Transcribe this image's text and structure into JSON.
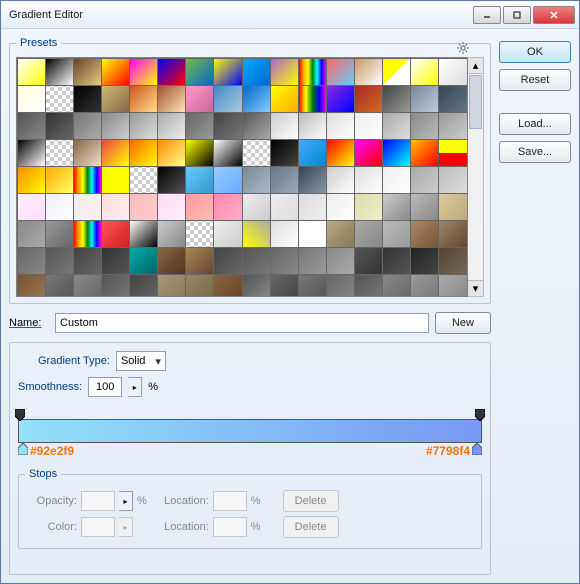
{
  "window": {
    "title": "Gradient Editor"
  },
  "buttons": {
    "ok": "OK",
    "reset": "Reset",
    "load": "Load...",
    "save": "Save...",
    "new": "New",
    "delete": "Delete"
  },
  "presets": {
    "legend": "Presets"
  },
  "name": {
    "label": "Name:",
    "value": "Custom"
  },
  "gradient": {
    "type_label": "Gradient Type:",
    "type_value": "Solid",
    "smooth_label": "Smoothness:",
    "smooth_value": "100",
    "pct": "%",
    "left_hex": "#92e2f9",
    "right_hex": "#7798f4"
  },
  "stops": {
    "legend": "Stops",
    "opacity": "Opacity:",
    "location": "Location:",
    "color": "Color:"
  },
  "swatches": [
    "linear-gradient(135deg,#fff,#ff0)",
    "linear-gradient(135deg,#000,#fff)",
    "linear-gradient(135deg,#6b4226,#e6c98a)",
    "linear-gradient(135deg,#ff0,#f00)",
    "linear-gradient(135deg,#f0f,#ff0)",
    "linear-gradient(135deg,#00f,#f00)",
    "linear-gradient(135deg,#7b4,#06c)",
    "linear-gradient(135deg,#ff0,#00f)",
    "linear-gradient(135deg,#0af,#06c)",
    "linear-gradient(135deg,#a6c,#ff0)",
    "linear-gradient(90deg,red,orange,yellow,green,cyan,blue,magenta)",
    "linear-gradient(135deg,#f66,#6cf)",
    "linear-gradient(135deg,#c96,#fff)",
    "linear-gradient(135deg,#ff0,#ff0 50%,transparent 50%)",
    "linear-gradient(135deg,#fff,#ff0)",
    "linear-gradient(135deg,#fff,#ddd)",
    "linear-gradient(135deg,#ffd,#fff)",
    "repeating-conic-gradient(#ccc 0 25%,#fff 0 50%) 0/8px 8px",
    "linear-gradient(135deg,#000,#333)",
    "linear-gradient(135deg,#cb7,#864)",
    "linear-gradient(135deg,#c52,#fd8)",
    "linear-gradient(135deg,#a0522d,#ffe4b5)",
    "linear-gradient(135deg,#f9c,#c69)",
    "linear-gradient(135deg,#48c,#acd)",
    "linear-gradient(135deg,#06c,#8cf)",
    "linear-gradient(135deg,#ff0,#fa0)",
    "linear-gradient(90deg,red,yellow,green,blue,magenta)",
    "linear-gradient(135deg,#8a2be2,#00f)",
    "linear-gradient(135deg,#a52a2a,#d2691e)",
    "linear-gradient(135deg,#444,#999)",
    "linear-gradient(135deg,#789,#bcd)",
    "linear-gradient(135deg,#345,#678)",
    "linear-gradient(135deg,#555,#888)",
    "linear-gradient(135deg,#333,#666)",
    "linear-gradient(135deg,#777,#aaa)",
    "linear-gradient(135deg,#888,#ccc)",
    "linear-gradient(135deg,#999,#ddd)",
    "linear-gradient(135deg,#aaa,#eee)",
    "linear-gradient(135deg,#666,#999)",
    "linear-gradient(135deg,#444,#777)",
    "linear-gradient(135deg,#555,#aaa)",
    "linear-gradient(135deg,#ccc,#fff)",
    "linear-gradient(135deg,#bbb,#fff)",
    "linear-gradient(135deg,#ddd,#fff)",
    "linear-gradient(135deg,#eee,#fff)",
    "linear-gradient(135deg,#aaa,#ddd)",
    "linear-gradient(135deg,#888,#bbb)",
    "linear-gradient(135deg,#999,#ccc)",
    "linear-gradient(135deg,#000,#fff)",
    "repeating-conic-gradient(#ccc 0 25%,#fff 0 50%) 0/8px 8px",
    "linear-gradient(135deg,#864,#edc)",
    "linear-gradient(135deg,#e44,#ff0)",
    "linear-gradient(135deg,#f60,#ff0)",
    "linear-gradient(135deg,#f80,#ff8)",
    "linear-gradient(135deg,#ff0,#000)",
    "linear-gradient(135deg,#fff,#000)",
    "repeating-conic-gradient(#ccc 0 25%,#fff 0 50%) 0/8px 8px",
    "linear-gradient(135deg,#000,#444)",
    "linear-gradient(135deg,#4af,#08c)",
    "linear-gradient(135deg,#f00,#ff0)",
    "linear-gradient(135deg,#f0f,#f00)",
    "linear-gradient(135deg,#00f,#0ff)",
    "linear-gradient(135deg,#fb0,#f00)",
    "linear-gradient(180deg,#ff0 0,#ff0 50%,#f00 50%)",
    "linear-gradient(135deg,#f80,#ff0)",
    "linear-gradient(135deg,#fa0,#ff6)",
    "linear-gradient(90deg,red,orange,yellow,green,cyan,blue,magenta)",
    "linear-gradient(135deg,#ff0,#ff0)",
    "repeating-conic-gradient(#ccc 0 25%,#fff 0 50%) 0/8px 8px",
    "linear-gradient(135deg,#000,#555)",
    "linear-gradient(135deg,#6cf,#39c)",
    "linear-gradient(135deg,#9cf,#6af)",
    "linear-gradient(135deg,#789,#abc)",
    "linear-gradient(135deg,#678,#9ab)",
    "linear-gradient(135deg,#345,#89a)",
    "linear-gradient(135deg,#ccc,#fff)",
    "linear-gradient(135deg,#ddd,#fff)",
    "linear-gradient(135deg,#eee,#fff)",
    "linear-gradient(135deg,#aaa,#ccc)",
    "linear-gradient(135deg,#bbb,#ddd)",
    "linear-gradient(135deg,#fef,#fdf)",
    "linear-gradient(135deg,#eef,#fff)",
    "linear-gradient(135deg,#eee,#fee)",
    "linear-gradient(135deg,#fdd,#fee)",
    "linear-gradient(135deg,#fbb,#fcc)",
    "linear-gradient(135deg,#fde,#fef)",
    "linear-gradient(135deg,#f99,#fbb)",
    "linear-gradient(135deg,#f8a,#fac)",
    "linear-gradient(135deg,#eee,#ccc)",
    "linear-gradient(135deg,#eee,#ddd)",
    "linear-gradient(135deg,#ddd,#eee)",
    "linear-gradient(135deg,#eee,#fff)",
    "linear-gradient(135deg,#dda,#eec)",
    "linear-gradient(135deg,#ccc,#888)",
    "linear-gradient(135deg,#bbb,#888)",
    "linear-gradient(135deg,#dc9,#ba7)",
    "linear-gradient(135deg,#888,#aaa)",
    "linear-gradient(135deg,#999,#666)",
    "linear-gradient(90deg,red,orange,yellow,green,cyan,blue,magenta)",
    "linear-gradient(135deg,#f55,#c22)",
    "linear-gradient(135deg,#fff,#000)",
    "linear-gradient(135deg,#ccc,#888)",
    "repeating-conic-gradient(#ccc 0 25%,#fff 0 50%) 0/8px 8px",
    "linear-gradient(135deg,#eee,#ccc)",
    "linear-gradient(45deg,#ff0,#aaa)",
    "linear-gradient(135deg,#ddd,#fff)",
    "linear-gradient(135deg,#fff,#fff)",
    "linear-gradient(135deg,#ba8,#875)",
    "linear-gradient(135deg,#aaa,#888)",
    "linear-gradient(135deg,#bbb,#999)",
    "linear-gradient(135deg,#a86,#753)",
    "linear-gradient(135deg,#986,#643)",
    "linear-gradient(135deg,#666,#888)",
    "linear-gradient(135deg,#555,#777)",
    "linear-gradient(135deg,#444,#666)",
    "linear-gradient(135deg,#333,#555)",
    "linear-gradient(135deg,#0aa,#066)",
    "linear-gradient(135deg,#864,#532)",
    "linear-gradient(135deg,#a85,#643)",
    "linear-gradient(135deg,#444,#666)",
    "linear-gradient(135deg,#555,#777)",
    "linear-gradient(135deg,#666,#888)",
    "linear-gradient(135deg,#777,#999)",
    "linear-gradient(135deg,#888,#aaa)",
    "linear-gradient(135deg,#555,#333)",
    "linear-gradient(135deg,#333,#555)",
    "linear-gradient(135deg,#222,#444)",
    "linear-gradient(135deg,#543,#765)",
    "linear-gradient(135deg,#753,#975)",
    "linear-gradient(135deg,#777,#555)",
    "linear-gradient(135deg,#888,#666)",
    "linear-gradient(135deg,#555,#777)",
    "linear-gradient(135deg,#444,#666)",
    "linear-gradient(135deg,#a97,#875)",
    "linear-gradient(135deg,#986,#764)",
    "linear-gradient(135deg,#864,#642)",
    "linear-gradient(135deg,#555,#888)",
    "linear-gradient(135deg,#666,#444)",
    "linear-gradient(135deg,#777,#555)",
    "linear-gradient(135deg,#666,#888)",
    "linear-gradient(135deg,#555,#777)",
    "linear-gradient(135deg,#888,#666)",
    "linear-gradient(135deg,#999,#777)",
    "linear-gradient(135deg,#aaa,#888)"
  ]
}
